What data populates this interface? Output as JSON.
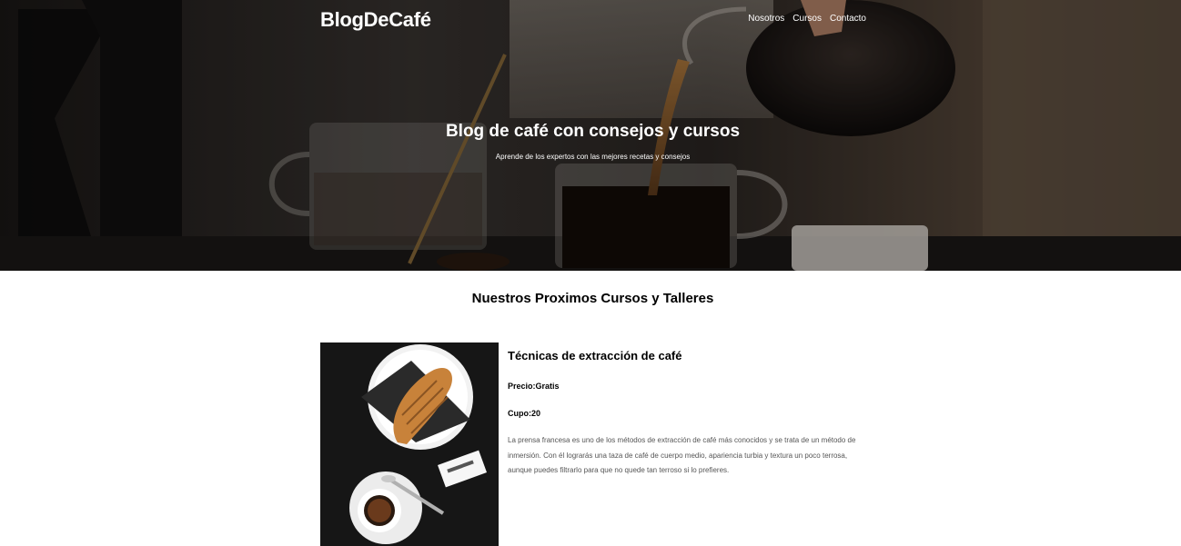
{
  "colors": {
    "hero_text": "#ffffff",
    "heading": "#000000",
    "body_text": "#555555",
    "coffee": "#2a1a10",
    "croissant": "#c8823a"
  },
  "header": {
    "logo": "BlogDeCafé",
    "nav": [
      "Nosotros",
      "Cursos",
      "Contacto"
    ]
  },
  "hero": {
    "image_icon": "coffee-pour-photo",
    "title": "Blog de café con consejos y cursos",
    "subtitle": "Aprende de los expertos con las mejores recetas y consejos"
  },
  "courses": {
    "section_title": "Nuestros Proximos Cursos y Talleres",
    "items": [
      {
        "image_icon": "croissant-and-espresso-photo",
        "title": "Técnicas de extracción de café",
        "price": "Precio:Gratis",
        "cupo": "Cupo:20",
        "description": "La prensa francesa es uno de los métodos de extracción de café más conocidos y se trata de un método de inmersión. Con él lograrás una taza de café de cuerpo medio, apariencia turbia y textura un poco terrosa, aunque puedes filtrarlo para que no quede tan terroso si lo prefieres."
      }
    ]
  }
}
